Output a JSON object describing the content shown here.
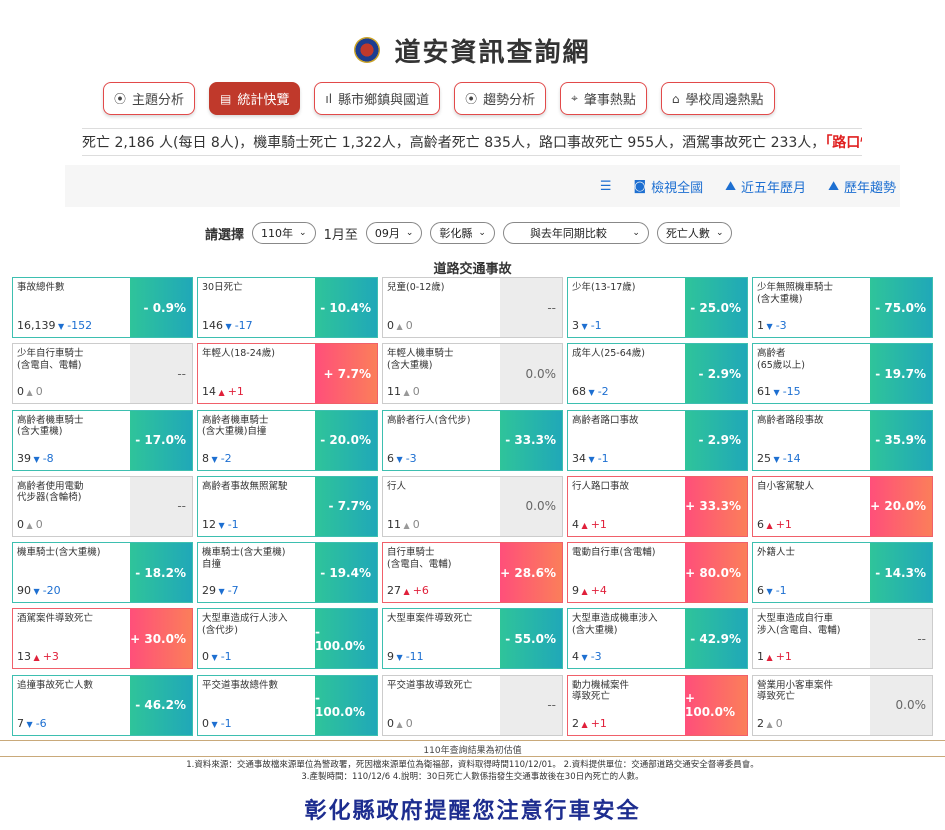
{
  "site": {
    "title": "道安資訊查詢網"
  },
  "nav": [
    {
      "icon": "⦿",
      "label": "主題分析"
    },
    {
      "icon": "▤",
      "label": "統計快覽"
    },
    {
      "icon": "ıl",
      "label": "縣市鄉鎮與國道"
    },
    {
      "icon": "⦿",
      "label": "趨勢分析"
    },
    {
      "icon": "⌖",
      "label": "肇事熱點"
    },
    {
      "icon": "⌂",
      "label": "學校周邊熱點"
    }
  ],
  "ticker": {
    "text": "死亡 2,186 人(每日 8人)，機車騎士死亡 1,322人，高齡者死亡 835人，路口事故死亡 955人，酒駕事故死亡 233人，",
    "highlight": "「路口慢看停」"
  },
  "toolbar": {
    "menu_icon": "☰",
    "view_all": "檢視全國",
    "five_year": "近五年歷月",
    "trend": "歷年趨勢"
  },
  "filters": {
    "label": "請選擇",
    "year": "110年",
    "from_text": "1月至",
    "month": "09月",
    "county": "彰化縣",
    "compare": "與去年同期比較",
    "metric": "死亡人數"
  },
  "section_title": "道路交通事故",
  "cards": [
    {
      "name": "事故總件數",
      "value": "16,139",
      "diff": "-152",
      "dir": "down",
      "pct": "- 0.9%",
      "tone": "teal"
    },
    {
      "name": "30日死亡",
      "value": "146",
      "diff": "-17",
      "dir": "down",
      "pct": "- 10.4%",
      "tone": "teal"
    },
    {
      "name": "兒童(0-12歲)",
      "value": "0",
      "diff": "0",
      "dir": "zero",
      "pct": "--",
      "tone": "gray"
    },
    {
      "name": "少年(13-17歲)",
      "value": "3",
      "diff": "-1",
      "dir": "down",
      "pct": "- 25.0%",
      "tone": "teal"
    },
    {
      "name": "少年無照機車騎士\n(含大重機)",
      "value": "1",
      "diff": "-3",
      "dir": "down",
      "pct": "- 75.0%",
      "tone": "teal"
    },
    {
      "name": "少年自行車騎士\n(含電自、電輔)",
      "value": "0",
      "diff": "0",
      "dir": "zero",
      "pct": "--",
      "tone": "gray"
    },
    {
      "name": "年輕人(18-24歲)",
      "value": "14",
      "diff": "+1",
      "dir": "up",
      "pct": "+ 7.7%",
      "tone": "red"
    },
    {
      "name": "年輕人機車騎士\n(含大重機)",
      "value": "11",
      "diff": "0",
      "dir": "zero",
      "pct": "0.0%",
      "tone": "gray"
    },
    {
      "name": "成年人(25-64歲)",
      "value": "68",
      "diff": "-2",
      "dir": "down",
      "pct": "- 2.9%",
      "tone": "teal"
    },
    {
      "name": "高齡者\n(65歲以上)",
      "value": "61",
      "diff": "-15",
      "dir": "down",
      "pct": "- 19.7%",
      "tone": "teal"
    },
    {
      "name": "高齡者機車騎士\n(含大重機)",
      "value": "39",
      "diff": "-8",
      "dir": "down",
      "pct": "- 17.0%",
      "tone": "teal"
    },
    {
      "name": "高齡者機車騎士\n(含大重機)自撞",
      "value": "8",
      "diff": "-2",
      "dir": "down",
      "pct": "- 20.0%",
      "tone": "teal"
    },
    {
      "name": "高齡者行人(含代步)",
      "value": "6",
      "diff": "-3",
      "dir": "down",
      "pct": "- 33.3%",
      "tone": "teal"
    },
    {
      "name": "高齡者路口事故",
      "value": "34",
      "diff": "-1",
      "dir": "down",
      "pct": "- 2.9%",
      "tone": "teal"
    },
    {
      "name": "高齡者路段事故",
      "value": "25",
      "diff": "-14",
      "dir": "down",
      "pct": "- 35.9%",
      "tone": "teal"
    },
    {
      "name": "高齡者使用電動\n代步器(含輪椅)",
      "value": "0",
      "diff": "0",
      "dir": "zero",
      "pct": "--",
      "tone": "gray"
    },
    {
      "name": "高齡者事故無照駕駛",
      "value": "12",
      "diff": "-1",
      "dir": "down",
      "pct": "- 7.7%",
      "tone": "teal"
    },
    {
      "name": "行人",
      "value": "11",
      "diff": "0",
      "dir": "zero",
      "pct": "0.0%",
      "tone": "gray"
    },
    {
      "name": "行人路口事故",
      "value": "4",
      "diff": "+1",
      "dir": "up",
      "pct": "+ 33.3%",
      "tone": "red"
    },
    {
      "name": "自小客駕駛人",
      "value": "6",
      "diff": "+1",
      "dir": "up",
      "pct": "+ 20.0%",
      "tone": "red"
    },
    {
      "name": "機車騎士(含大重機)",
      "value": "90",
      "diff": "-20",
      "dir": "down",
      "pct": "- 18.2%",
      "tone": "teal"
    },
    {
      "name": "機車騎士(含大重機)\n自撞",
      "value": "29",
      "diff": "-7",
      "dir": "down",
      "pct": "- 19.4%",
      "tone": "teal"
    },
    {
      "name": "自行車騎士\n(含電自、電輔)",
      "value": "27",
      "diff": "+6",
      "dir": "up",
      "pct": "+ 28.6%",
      "tone": "red"
    },
    {
      "name": "電動自行車(含電輔)",
      "value": "9",
      "diff": "+4",
      "dir": "up",
      "pct": "+ 80.0%",
      "tone": "red"
    },
    {
      "name": "外籍人士",
      "value": "6",
      "diff": "-1",
      "dir": "down",
      "pct": "- 14.3%",
      "tone": "teal"
    },
    {
      "name": "酒駕案件導致死亡",
      "value": "13",
      "diff": "+3",
      "dir": "up",
      "pct": "+ 30.0%",
      "tone": "red"
    },
    {
      "name": "大型車造成行人涉入\n(含代步)",
      "value": "0",
      "diff": "-1",
      "dir": "down",
      "pct": "- 100.0%",
      "tone": "teal"
    },
    {
      "name": "大型車案件導致死亡",
      "value": "9",
      "diff": "-11",
      "dir": "down",
      "pct": "- 55.0%",
      "tone": "teal"
    },
    {
      "name": "大型車造成機車涉入\n(含大重機)",
      "value": "4",
      "diff": "-3",
      "dir": "down",
      "pct": "- 42.9%",
      "tone": "teal"
    },
    {
      "name": "大型車造成自行車\n涉入(含電自、電輔)",
      "value": "1",
      "diff": "+1",
      "dir": "up",
      "pct": "--",
      "tone": "gray"
    },
    {
      "name": "追撞事故死亡人數",
      "value": "7",
      "diff": "-6",
      "dir": "down",
      "pct": "- 46.2%",
      "tone": "teal"
    },
    {
      "name": "平交道事故總件數",
      "value": "0",
      "diff": "-1",
      "dir": "down",
      "pct": "- 100.0%",
      "tone": "teal"
    },
    {
      "name": "平交道事故導致死亡",
      "value": "0",
      "diff": "0",
      "dir": "zero",
      "pct": "--",
      "tone": "gray"
    },
    {
      "name": "動力機械案件\n導致死亡",
      "value": "2",
      "diff": "+1",
      "dir": "up",
      "pct": "+ 100.0%",
      "tone": "red"
    },
    {
      "name": "營業用小客車案件\n導致死亡",
      "value": "2",
      "diff": "0",
      "dir": "zero",
      "pct": "0.0%",
      "tone": "gray"
    }
  ],
  "footnote": "110年查詢結果為初估值",
  "notes": {
    "line1": "1.資料來源：交通事故檔來源單位為警政署，死因檔來源單位為衛福部，資料取得時間110/12/01。 2.資料提供單位：交通部道路交通安全督導委員會。",
    "line2": "3.產製時間：110/12/6 4.說明：30日死亡人數係指發生交通事故後在30日內死亡的人數。"
  },
  "slogan": "彰化縣政府提醒您注意行車安全"
}
